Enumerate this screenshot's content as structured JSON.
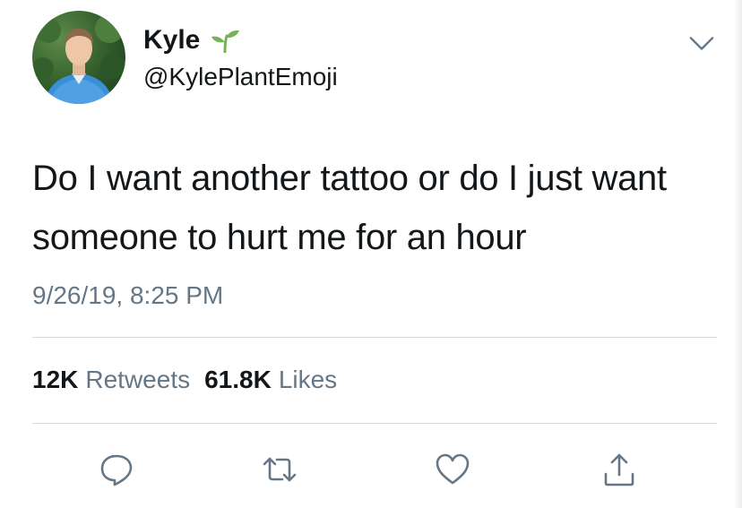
{
  "author": {
    "display_name": "Kyle",
    "handle": "@KylePlantEmoji",
    "name_emoji": "sprout-icon",
    "avatar": "avatar-photo"
  },
  "tweet": {
    "text_line1": "Do I want another tattoo or do I just want",
    "text_line2": "someone to hurt me for an hour",
    "timestamp": "9/26/19, 8:25 PM"
  },
  "stats": {
    "retweets_count": "12K",
    "retweets_label": "Retweets",
    "likes_count": "61.8K",
    "likes_label": "Likes"
  },
  "actions": [
    {
      "name": "reply",
      "icon": "reply-icon"
    },
    {
      "name": "retweet",
      "icon": "retweet-icon"
    },
    {
      "name": "like",
      "icon": "heart-icon"
    },
    {
      "name": "share",
      "icon": "share-icon"
    }
  ],
  "colors": {
    "text": "#14171a",
    "secondary": "#657786",
    "divider": "#d6d9db",
    "sprout": "#77b255"
  }
}
